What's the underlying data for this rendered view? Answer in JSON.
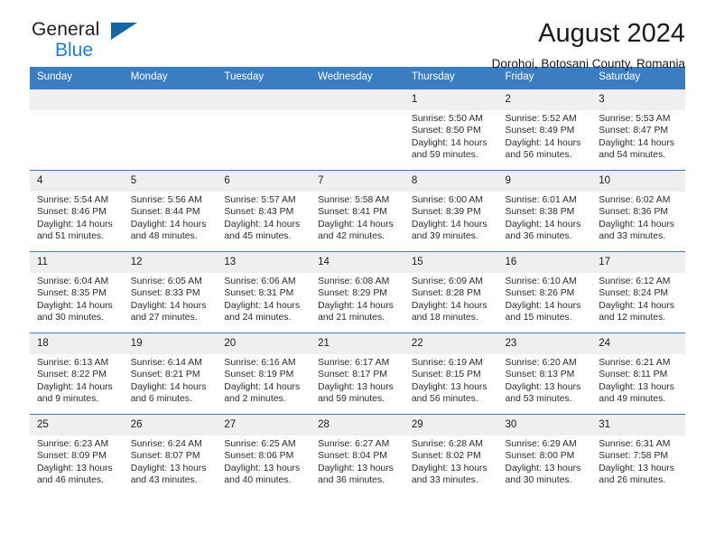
{
  "brand": {
    "name_top": "General",
    "name_bottom": "Blue",
    "triangle_color": "#1266a8",
    "blue_color": "#1b7fd4"
  },
  "header": {
    "title": "August 2024",
    "subtitle": "Dorohoi, Botosani County, Romania"
  },
  "theme": {
    "header_bg": "#3a7dc0",
    "daynum_bg": "#efefef",
    "rule_color": "#3a7dc0"
  },
  "weekday_headers": [
    "Sunday",
    "Monday",
    "Tuesday",
    "Wednesday",
    "Thursday",
    "Friday",
    "Saturday"
  ],
  "labels": {
    "sunrise": "Sunrise:",
    "sunset": "Sunset:",
    "daylight": "Daylight:"
  },
  "weeks": [
    [
      {
        "day": ""
      },
      {
        "day": ""
      },
      {
        "day": ""
      },
      {
        "day": ""
      },
      {
        "day": "1",
        "sunrise": "Sunrise: 5:50 AM",
        "sunset": "Sunset: 8:50 PM",
        "daylight": "Daylight: 14 hours and 59 minutes."
      },
      {
        "day": "2",
        "sunrise": "Sunrise: 5:52 AM",
        "sunset": "Sunset: 8:49 PM",
        "daylight": "Daylight: 14 hours and 56 minutes."
      },
      {
        "day": "3",
        "sunrise": "Sunrise: 5:53 AM",
        "sunset": "Sunset: 8:47 PM",
        "daylight": "Daylight: 14 hours and 54 minutes."
      }
    ],
    [
      {
        "day": "4",
        "sunrise": "Sunrise: 5:54 AM",
        "sunset": "Sunset: 8:46 PM",
        "daylight": "Daylight: 14 hours and 51 minutes."
      },
      {
        "day": "5",
        "sunrise": "Sunrise: 5:56 AM",
        "sunset": "Sunset: 8:44 PM",
        "daylight": "Daylight: 14 hours and 48 minutes."
      },
      {
        "day": "6",
        "sunrise": "Sunrise: 5:57 AM",
        "sunset": "Sunset: 8:43 PM",
        "daylight": "Daylight: 14 hours and 45 minutes."
      },
      {
        "day": "7",
        "sunrise": "Sunrise: 5:58 AM",
        "sunset": "Sunset: 8:41 PM",
        "daylight": "Daylight: 14 hours and 42 minutes."
      },
      {
        "day": "8",
        "sunrise": "Sunrise: 6:00 AM",
        "sunset": "Sunset: 8:39 PM",
        "daylight": "Daylight: 14 hours and 39 minutes."
      },
      {
        "day": "9",
        "sunrise": "Sunrise: 6:01 AM",
        "sunset": "Sunset: 8:38 PM",
        "daylight": "Daylight: 14 hours and 36 minutes."
      },
      {
        "day": "10",
        "sunrise": "Sunrise: 6:02 AM",
        "sunset": "Sunset: 8:36 PM",
        "daylight": "Daylight: 14 hours and 33 minutes."
      }
    ],
    [
      {
        "day": "11",
        "sunrise": "Sunrise: 6:04 AM",
        "sunset": "Sunset: 8:35 PM",
        "daylight": "Daylight: 14 hours and 30 minutes."
      },
      {
        "day": "12",
        "sunrise": "Sunrise: 6:05 AM",
        "sunset": "Sunset: 8:33 PM",
        "daylight": "Daylight: 14 hours and 27 minutes."
      },
      {
        "day": "13",
        "sunrise": "Sunrise: 6:06 AM",
        "sunset": "Sunset: 8:31 PM",
        "daylight": "Daylight: 14 hours and 24 minutes."
      },
      {
        "day": "14",
        "sunrise": "Sunrise: 6:08 AM",
        "sunset": "Sunset: 8:29 PM",
        "daylight": "Daylight: 14 hours and 21 minutes."
      },
      {
        "day": "15",
        "sunrise": "Sunrise: 6:09 AM",
        "sunset": "Sunset: 8:28 PM",
        "daylight": "Daylight: 14 hours and 18 minutes."
      },
      {
        "day": "16",
        "sunrise": "Sunrise: 6:10 AM",
        "sunset": "Sunset: 8:26 PM",
        "daylight": "Daylight: 14 hours and 15 minutes."
      },
      {
        "day": "17",
        "sunrise": "Sunrise: 6:12 AM",
        "sunset": "Sunset: 8:24 PM",
        "daylight": "Daylight: 14 hours and 12 minutes."
      }
    ],
    [
      {
        "day": "18",
        "sunrise": "Sunrise: 6:13 AM",
        "sunset": "Sunset: 8:22 PM",
        "daylight": "Daylight: 14 hours and 9 minutes."
      },
      {
        "day": "19",
        "sunrise": "Sunrise: 6:14 AM",
        "sunset": "Sunset: 8:21 PM",
        "daylight": "Daylight: 14 hours and 6 minutes."
      },
      {
        "day": "20",
        "sunrise": "Sunrise: 6:16 AM",
        "sunset": "Sunset: 8:19 PM",
        "daylight": "Daylight: 14 hours and 2 minutes."
      },
      {
        "day": "21",
        "sunrise": "Sunrise: 6:17 AM",
        "sunset": "Sunset: 8:17 PM",
        "daylight": "Daylight: 13 hours and 59 minutes."
      },
      {
        "day": "22",
        "sunrise": "Sunrise: 6:19 AM",
        "sunset": "Sunset: 8:15 PM",
        "daylight": "Daylight: 13 hours and 56 minutes."
      },
      {
        "day": "23",
        "sunrise": "Sunrise: 6:20 AM",
        "sunset": "Sunset: 8:13 PM",
        "daylight": "Daylight: 13 hours and 53 minutes."
      },
      {
        "day": "24",
        "sunrise": "Sunrise: 6:21 AM",
        "sunset": "Sunset: 8:11 PM",
        "daylight": "Daylight: 13 hours and 49 minutes."
      }
    ],
    [
      {
        "day": "25",
        "sunrise": "Sunrise: 6:23 AM",
        "sunset": "Sunset: 8:09 PM",
        "daylight": "Daylight: 13 hours and 46 minutes."
      },
      {
        "day": "26",
        "sunrise": "Sunrise: 6:24 AM",
        "sunset": "Sunset: 8:07 PM",
        "daylight": "Daylight: 13 hours and 43 minutes."
      },
      {
        "day": "27",
        "sunrise": "Sunrise: 6:25 AM",
        "sunset": "Sunset: 8:06 PM",
        "daylight": "Daylight: 13 hours and 40 minutes."
      },
      {
        "day": "28",
        "sunrise": "Sunrise: 6:27 AM",
        "sunset": "Sunset: 8:04 PM",
        "daylight": "Daylight: 13 hours and 36 minutes."
      },
      {
        "day": "29",
        "sunrise": "Sunrise: 6:28 AM",
        "sunset": "Sunset: 8:02 PM",
        "daylight": "Daylight: 13 hours and 33 minutes."
      },
      {
        "day": "30",
        "sunrise": "Sunrise: 6:29 AM",
        "sunset": "Sunset: 8:00 PM",
        "daylight": "Daylight: 13 hours and 30 minutes."
      },
      {
        "day": "31",
        "sunrise": "Sunrise: 6:31 AM",
        "sunset": "Sunset: 7:58 PM",
        "daylight": "Daylight: 13 hours and 26 minutes."
      }
    ]
  ]
}
